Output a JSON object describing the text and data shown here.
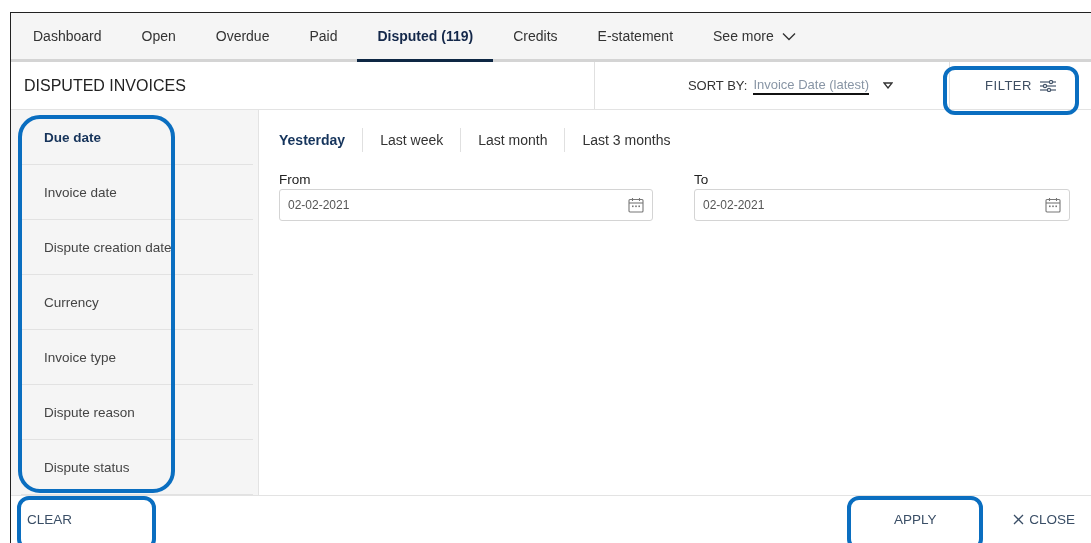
{
  "tabs": [
    {
      "label": "Dashboard",
      "selected": false,
      "kind": "plain"
    },
    {
      "label": "Open",
      "selected": false,
      "kind": "plain"
    },
    {
      "label": "Overdue",
      "selected": false,
      "kind": "plain"
    },
    {
      "label": "Paid",
      "selected": false,
      "kind": "plain"
    },
    {
      "label": "Disputed (119)",
      "selected": true,
      "kind": "plain"
    },
    {
      "label": "Credits",
      "selected": false,
      "kind": "plain"
    },
    {
      "label": "E-statement",
      "selected": false,
      "kind": "plain"
    },
    {
      "label": "See more",
      "selected": false,
      "kind": "dropdown"
    }
  ],
  "header": {
    "title": "DISPUTED INVOICES",
    "sort_label": "SORT BY:",
    "sort_value": "Invoice Date (latest)",
    "filter_button": {
      "label": "FILTER",
      "highlighted": true
    }
  },
  "filter_panel": {
    "highlighted": true,
    "categories": [
      {
        "label": "Due date",
        "selected": true
      },
      {
        "label": "Invoice date",
        "selected": false
      },
      {
        "label": "Dispute creation date",
        "selected": false
      },
      {
        "label": "Currency",
        "selected": false
      },
      {
        "label": "Invoice type",
        "selected": false
      },
      {
        "label": "Dispute reason",
        "selected": false
      },
      {
        "label": "Dispute status",
        "selected": false
      }
    ],
    "ranges": [
      {
        "label": "Yesterday",
        "selected": true
      },
      {
        "label": "Last week",
        "selected": false
      },
      {
        "label": "Last month",
        "selected": false
      },
      {
        "label": "Last 3 months",
        "selected": false
      }
    ],
    "fields": [
      {
        "label": "From",
        "value": "02-02-2021"
      },
      {
        "label": "To",
        "value": "02-02-2021"
      }
    ]
  },
  "footer": {
    "buttons": [
      {
        "kind": "clear",
        "label": "CLEAR",
        "highlighted": true
      },
      {
        "kind": "apply",
        "label": "APPLY",
        "highlighted": true
      },
      {
        "kind": "close",
        "label": "CLOSE",
        "highlighted": false
      }
    ]
  }
}
